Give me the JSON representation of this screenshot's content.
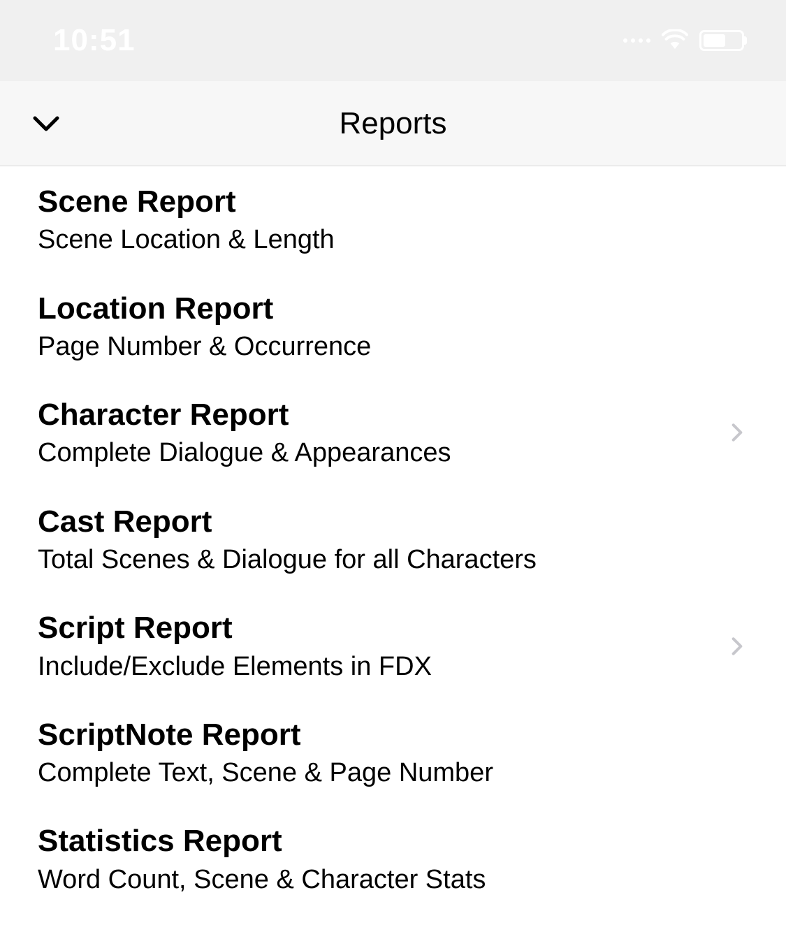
{
  "status_bar": {
    "time": "10:51"
  },
  "header": {
    "title": "Reports"
  },
  "reports": [
    {
      "title": "Scene Report",
      "subtitle": "Scene Location & Length",
      "has_disclosure": false
    },
    {
      "title": "Location Report",
      "subtitle": "Page Number & Occurrence",
      "has_disclosure": false
    },
    {
      "title": "Character Report",
      "subtitle": "Complete Dialogue & Appearances",
      "has_disclosure": true
    },
    {
      "title": "Cast Report",
      "subtitle": "Total Scenes & Dialogue for all Characters",
      "has_disclosure": false
    },
    {
      "title": "Script Report",
      "subtitle": "Include/Exclude Elements in FDX",
      "has_disclosure": true
    },
    {
      "title": "ScriptNote Report",
      "subtitle": "Complete Text, Scene & Page Number",
      "has_disclosure": false
    },
    {
      "title": "Statistics Report",
      "subtitle": "Word Count, Scene & Character Stats",
      "has_disclosure": false
    }
  ]
}
